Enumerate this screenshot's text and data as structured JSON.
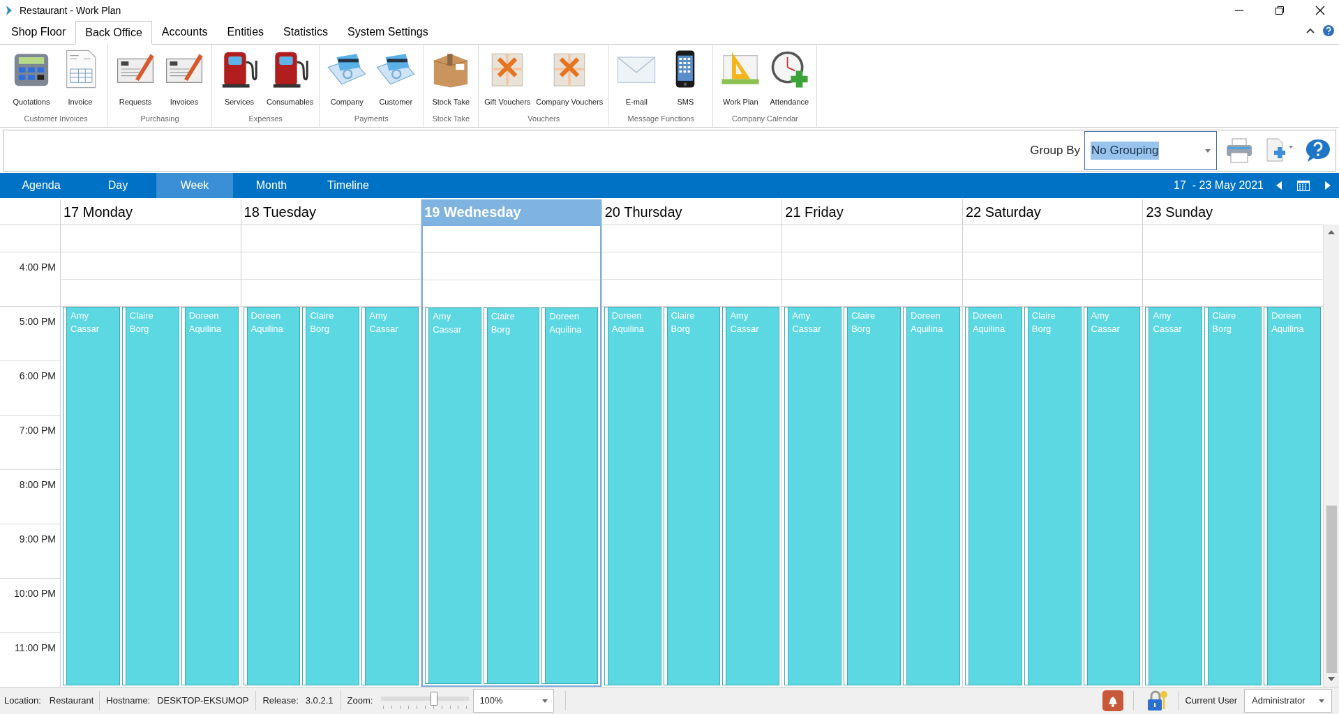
{
  "window": {
    "title": "Restaurant - Work Plan"
  },
  "menu_tabs": [
    {
      "label": "Shop Floor",
      "selected": false
    },
    {
      "label": "Back Office",
      "selected": true
    },
    {
      "label": "Accounts",
      "selected": false
    },
    {
      "label": "Entities",
      "selected": false
    },
    {
      "label": "Statistics",
      "selected": false
    },
    {
      "label": "System Settings",
      "selected": false
    }
  ],
  "ribbon_groups": [
    {
      "label": "Customer Invoices",
      "buttons": [
        {
          "label": "Quotations",
          "kind": "calculator"
        },
        {
          "label": "Invoice",
          "kind": "document"
        }
      ]
    },
    {
      "label": "Purchasing",
      "buttons": [
        {
          "label": "Requests",
          "kind": "order"
        },
        {
          "label": "Invoices",
          "kind": "order"
        }
      ]
    },
    {
      "label": "Expenses",
      "buttons": [
        {
          "label": "Services",
          "kind": "pump"
        },
        {
          "label": "Consumables",
          "kind": "pump"
        }
      ]
    },
    {
      "label": "Payments",
      "buttons": [
        {
          "label": "Company",
          "kind": "payment"
        },
        {
          "label": "Customer",
          "kind": "payment"
        }
      ]
    },
    {
      "label": "Stock Take",
      "buttons": [
        {
          "label": "Stock Take",
          "kind": "box"
        }
      ]
    },
    {
      "label": "Vouchers",
      "buttons": [
        {
          "label": "Gift Vouchers",
          "kind": "gift"
        },
        {
          "label": "Company Vouchers",
          "kind": "gift"
        }
      ]
    },
    {
      "label": "Message Functions",
      "buttons": [
        {
          "label": "E-mail",
          "kind": "envelope"
        },
        {
          "label": "SMS",
          "kind": "phone"
        }
      ]
    },
    {
      "label": "Company Calendar",
      "buttons": [
        {
          "label": "Work Plan",
          "kind": "ruler"
        },
        {
          "label": "Attendance",
          "kind": "clock"
        }
      ]
    }
  ],
  "toolbar": {
    "group_by_label": "Group By",
    "group_by_value": "No Grouping"
  },
  "view_tabs": [
    {
      "label": "Agenda",
      "selected": false
    },
    {
      "label": "Day",
      "selected": false
    },
    {
      "label": "Week",
      "selected": true
    },
    {
      "label": "Month",
      "selected": false
    },
    {
      "label": "Timeline",
      "selected": false
    }
  ],
  "date_range": "17  - 23 May 2021",
  "time_labels": [
    "4:00 PM",
    "5:00 PM",
    "6:00 PM",
    "7:00 PM",
    "8:00 PM",
    "9:00 PM",
    "10:00 PM",
    "11:00 PM"
  ],
  "days": [
    {
      "label": "17 Monday",
      "selected": false,
      "shifts": [
        "Amy Cassar",
        "Claire Borg",
        "Doreen Aquilina"
      ]
    },
    {
      "label": "18 Tuesday",
      "selected": false,
      "shifts": [
        "Doreen Aquilina",
        "Claire Borg",
        "Amy Cassar"
      ]
    },
    {
      "label": "19 Wednesday",
      "selected": true,
      "shifts": [
        "Amy Cassar",
        "Claire Borg",
        "Doreen Aquilina"
      ]
    },
    {
      "label": "20 Thursday",
      "selected": false,
      "shifts": [
        "Doreen Aquilina",
        "Claire Borg",
        "Amy Cassar"
      ]
    },
    {
      "label": "21 Friday",
      "selected": false,
      "shifts": [
        "Amy Cassar",
        "Claire Borg",
        "Doreen Aquilina"
      ]
    },
    {
      "label": "22 Saturday",
      "selected": false,
      "shifts": [
        "Doreen Aquilina",
        "Claire Borg",
        "Amy Cassar"
      ]
    },
    {
      "label": "23 Sunday",
      "selected": false,
      "shifts": [
        "Amy Cassar",
        "Claire Borg",
        "Doreen Aquilina"
      ]
    }
  ],
  "status_bar": {
    "location_label": "Location:",
    "location": "Restaurant",
    "hostname_label": "Hostname:",
    "hostname": "DESKTOP-EKSUMOP",
    "release_label": "Release:",
    "release": "3.0.2.1",
    "zoom_label": "Zoom:",
    "zoom": {
      "level": 0.6
    },
    "zoom_value": "100%",
    "current_user_label": "Current User",
    "current_user": "Administrator"
  }
}
